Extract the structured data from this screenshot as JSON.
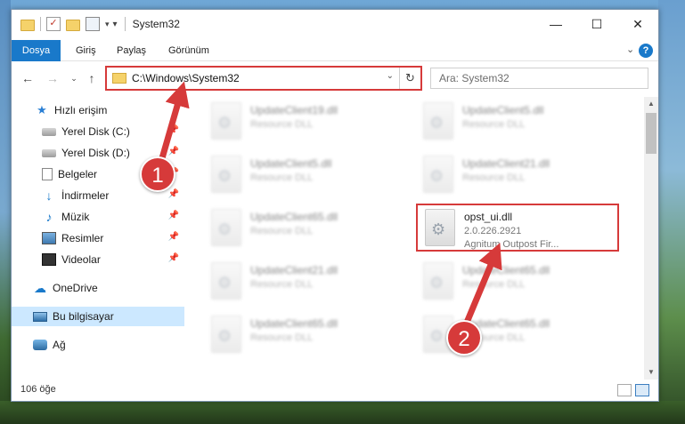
{
  "window": {
    "title": "System32"
  },
  "ribbon": {
    "tabs": [
      "Dosya",
      "Giriş",
      "Paylaş",
      "Görünüm"
    ]
  },
  "navbar": {
    "address_path": "C:\\Windows\\System32",
    "search_placeholder": "Ara: System32"
  },
  "sidebar": {
    "items": [
      {
        "label": "Hızlı erişim",
        "icon": "star-icon"
      },
      {
        "label": "Yerel Disk (C:)",
        "icon": "drive-icon",
        "pinned": true
      },
      {
        "label": "Yerel Disk (D:)",
        "icon": "drive-icon",
        "pinned": true
      },
      {
        "label": "Belgeler",
        "icon": "documents-icon",
        "pinned": true
      },
      {
        "label": "İndirmeler",
        "icon": "download-icon",
        "pinned": true
      },
      {
        "label": "Müzik",
        "icon": "music-icon",
        "pinned": true
      },
      {
        "label": "Resimler",
        "icon": "pictures-icon",
        "pinned": true
      },
      {
        "label": "Videolar",
        "icon": "videos-icon",
        "pinned": true
      },
      {
        "label": "OneDrive",
        "icon": "cloud-icon"
      },
      {
        "label": "Bu bilgisayar",
        "icon": "computer-icon",
        "selected": true
      },
      {
        "label": "Ağ",
        "icon": "network-icon"
      }
    ]
  },
  "files": [
    {
      "name": "UpdateClient19.dll",
      "desc": "Resource DLL",
      "blurred": true
    },
    {
      "name": "UpdateClient5.dll",
      "desc": "Resource DLL",
      "blurred": true
    },
    {
      "name": "UpdateClient5.dll",
      "desc": "Resource DLL",
      "blurred": true
    },
    {
      "name": "UpdateClient21.dll",
      "desc": "Resource DLL",
      "blurred": true
    },
    {
      "name": "UpdateClient65.dll",
      "desc": "Resource DLL",
      "blurred": true
    },
    {
      "name": "opst_ui.dll",
      "desc": "2.0.226.2921",
      "desc2": "Agnitum Outpost Fir...",
      "blurred": false,
      "highlight": true
    },
    {
      "name": "UpdateClient21.dll",
      "desc": "Resource DLL",
      "blurred": true
    },
    {
      "name": "UpdateClient65.dll",
      "desc": "Resource DLL",
      "blurred": true
    },
    {
      "name": "UpdateClient65.dll",
      "desc": "Resource DLL",
      "blurred": true
    },
    {
      "name": "UpdateClient65.dll",
      "desc": "Resource DLL",
      "blurred": true
    }
  ],
  "status": {
    "count": "106 öğe"
  },
  "annotations": {
    "badge1": "1",
    "badge2": "2",
    "color": "#d63a3a"
  }
}
